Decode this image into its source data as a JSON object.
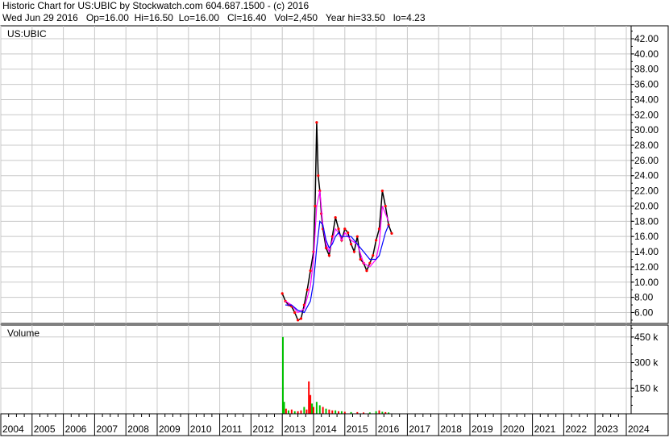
{
  "header": {
    "line1": "Historic Chart for US:UBIC by Stockwatch.com 604.687.1500 - (c) 2016",
    "line2": "Wed Jun 29 2016   Op=16.00  Hi=16.50  Lo=16.00   Cl=16.40   Vol=2,450   Year hi=33.50   lo=4.23"
  },
  "chart_data": [
    {
      "type": "line",
      "label": "US:UBIC",
      "ylim": [
        4.23,
        42
      ],
      "y_ticks": [
        "42.00",
        "40.00",
        "38.00",
        "36.00",
        "34.00",
        "32.00",
        "30.00",
        "28.00",
        "26.00",
        "24.00",
        "22.00",
        "20.00",
        "18.00",
        "16.00",
        "14.00",
        "12.00",
        "10.00",
        "8.00",
        "6.00"
      ],
      "y_tick_values": [
        42,
        40,
        38,
        36,
        34,
        32,
        30,
        28,
        26,
        24,
        22,
        20,
        18,
        16,
        14,
        12,
        10,
        8,
        6
      ],
      "x_labels": [
        "2004",
        "2005",
        "2006",
        "2007",
        "2008",
        "2009",
        "2010",
        "2011",
        "2012",
        "2013",
        "2014",
        "2015",
        "2016",
        "2017",
        "2018",
        "2019",
        "2020",
        "2021",
        "2022",
        "2023",
        "2024"
      ],
      "grid": true,
      "series": [
        {
          "role": "price",
          "color": "#000000",
          "x": [
            2013.0,
            2013.1,
            2013.2,
            2013.3,
            2013.4,
            2013.5,
            2013.6,
            2013.7,
            2013.8,
            2013.9,
            2014.0,
            2014.05,
            2014.1,
            2014.15,
            2014.2,
            2014.25,
            2014.3,
            2014.4,
            2014.5,
            2014.6,
            2014.7,
            2014.8,
            2014.9,
            2015.0,
            2015.1,
            2015.2,
            2015.3,
            2015.4,
            2015.5,
            2015.6,
            2015.7,
            2015.8,
            2015.9,
            2016.0,
            2016.1,
            2016.2,
            2016.3,
            2016.4,
            2016.5
          ],
          "y": [
            8.5,
            7.5,
            7.0,
            6.8,
            6.0,
            5.0,
            5.2,
            7.0,
            9.0,
            11.5,
            14.0,
            20.0,
            31.0,
            24.0,
            22.0,
            19.0,
            17.0,
            14.5,
            13.5,
            16.0,
            18.5,
            17.0,
            15.5,
            17.0,
            16.5,
            15.0,
            14.0,
            16.0,
            13.0,
            12.5,
            11.5,
            12.5,
            13.5,
            15.5,
            17.0,
            22.0,
            20.0,
            17.5,
            16.4
          ]
        },
        {
          "role": "moving-average-fast",
          "color": "#ff00ff",
          "x": [
            2013.1,
            2013.3,
            2013.5,
            2013.7,
            2013.9,
            2014.0,
            2014.1,
            2014.2,
            2014.3,
            2014.4,
            2014.5,
            2014.6,
            2014.7,
            2014.8,
            2014.9,
            2015.0,
            2015.2,
            2015.4,
            2015.6,
            2015.8,
            2016.0,
            2016.1,
            2016.2,
            2016.3,
            2016.4
          ],
          "y": [
            7.5,
            7.0,
            6.0,
            6.5,
            9.5,
            13.0,
            20.0,
            22.0,
            17.5,
            15.0,
            14.0,
            15.5,
            17.0,
            16.5,
            15.5,
            16.5,
            15.5,
            15.0,
            12.5,
            12.0,
            13.0,
            15.0,
            20.0,
            19.0,
            18.0
          ]
        },
        {
          "role": "moving-average-slow",
          "color": "#0000ff",
          "x": [
            2013.1,
            2013.3,
            2013.5,
            2013.7,
            2013.9,
            2014.0,
            2014.1,
            2014.2,
            2014.3,
            2014.4,
            2014.5,
            2014.6,
            2014.7,
            2014.8,
            2014.9,
            2015.0,
            2015.2,
            2015.4,
            2015.6,
            2015.8,
            2016.0,
            2016.1,
            2016.2,
            2016.3,
            2016.4
          ],
          "y": [
            7.0,
            7.0,
            6.3,
            6.0,
            7.5,
            10.0,
            14.5,
            18.0,
            17.5,
            15.5,
            14.5,
            15.0,
            16.0,
            16.5,
            16.0,
            16.0,
            16.0,
            15.0,
            14.0,
            13.0,
            13.0,
            13.5,
            15.0,
            16.5,
            17.5
          ]
        }
      ]
    },
    {
      "type": "bar",
      "label": "Volume",
      "ylim": [
        0,
        520000
      ],
      "y_ticks": [
        "450 k",
        "300 k",
        "150 k"
      ],
      "y_tick_values": [
        450000,
        300000,
        150000
      ],
      "colors": {
        "up": "#00c000",
        "down": "#ff0000"
      },
      "bars": [
        {
          "x": 2013.02,
          "value": 450000,
          "dir": "up"
        },
        {
          "x": 2013.06,
          "value": 70000,
          "dir": "up"
        },
        {
          "x": 2013.12,
          "value": 30000,
          "dir": "down"
        },
        {
          "x": 2013.2,
          "value": 20000,
          "dir": "up"
        },
        {
          "x": 2013.3,
          "value": 25000,
          "dir": "down"
        },
        {
          "x": 2013.4,
          "value": 15000,
          "dir": "up"
        },
        {
          "x": 2013.5,
          "value": 15000,
          "dir": "down"
        },
        {
          "x": 2013.6,
          "value": 20000,
          "dir": "down"
        },
        {
          "x": 2013.7,
          "value": 40000,
          "dir": "up"
        },
        {
          "x": 2013.78,
          "value": 25000,
          "dir": "down"
        },
        {
          "x": 2013.85,
          "value": 190000,
          "dir": "down"
        },
        {
          "x": 2013.9,
          "value": 110000,
          "dir": "down"
        },
        {
          "x": 2013.95,
          "value": 60000,
          "dir": "up"
        },
        {
          "x": 2014.0,
          "value": 40000,
          "dir": "down"
        },
        {
          "x": 2014.1,
          "value": 70000,
          "dir": "up"
        },
        {
          "x": 2014.2,
          "value": 50000,
          "dir": "up"
        },
        {
          "x": 2014.3,
          "value": 40000,
          "dir": "down"
        },
        {
          "x": 2014.4,
          "value": 30000,
          "dir": "up"
        },
        {
          "x": 2014.5,
          "value": 25000,
          "dir": "down"
        },
        {
          "x": 2014.6,
          "value": 20000,
          "dir": "down"
        },
        {
          "x": 2014.7,
          "value": 20000,
          "dir": "up"
        },
        {
          "x": 2014.8,
          "value": 15000,
          "dir": "down"
        },
        {
          "x": 2014.9,
          "value": 15000,
          "dir": "up"
        },
        {
          "x": 2015.0,
          "value": 12000,
          "dir": "down"
        },
        {
          "x": 2015.2,
          "value": 10000,
          "dir": "up"
        },
        {
          "x": 2015.4,
          "value": 10000,
          "dir": "down"
        },
        {
          "x": 2015.6,
          "value": 8000,
          "dir": "down"
        },
        {
          "x": 2015.8,
          "value": 8000,
          "dir": "up"
        },
        {
          "x": 2016.0,
          "value": 15000,
          "dir": "up"
        },
        {
          "x": 2016.1,
          "value": 20000,
          "dir": "down"
        },
        {
          "x": 2016.2,
          "value": 12000,
          "dir": "up"
        },
        {
          "x": 2016.3,
          "value": 10000,
          "dir": "down"
        },
        {
          "x": 2016.4,
          "value": 8000,
          "dir": "up"
        }
      ]
    }
  ]
}
